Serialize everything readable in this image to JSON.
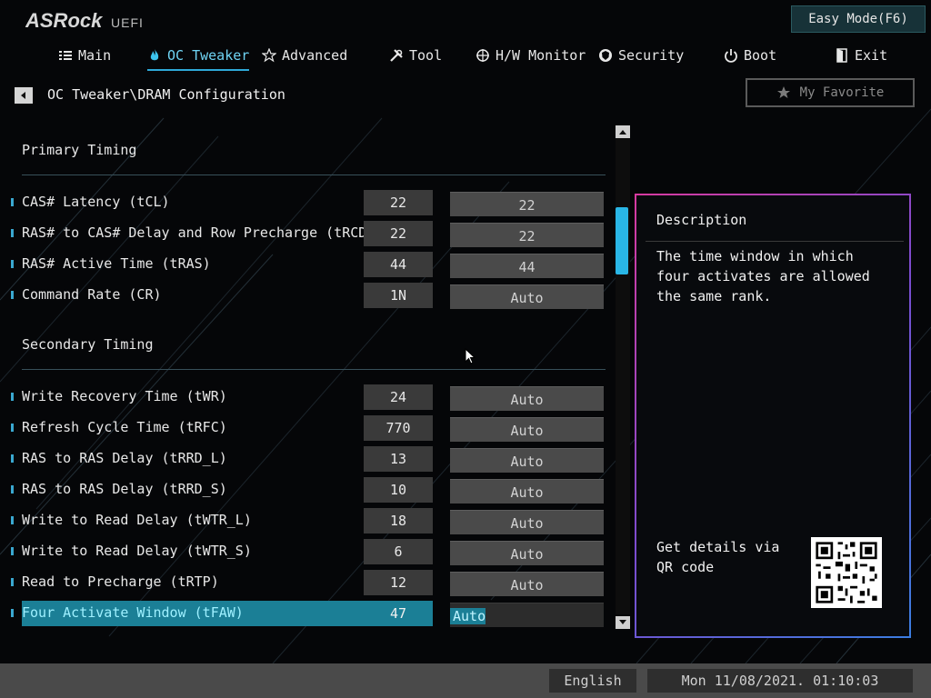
{
  "header": {
    "brand": "ASRock",
    "brand_suffix": "UEFI",
    "easy_mode_label": "Easy Mode(F6)"
  },
  "nav": {
    "items": [
      {
        "label": "Main",
        "icon": "list-icon"
      },
      {
        "label": "OC Tweaker",
        "icon": "flame-icon",
        "active": true
      },
      {
        "label": "Advanced",
        "icon": "star-icon"
      },
      {
        "label": "Tool",
        "icon": "tools-icon"
      },
      {
        "label": "H/W Monitor",
        "icon": "crosshair-icon"
      },
      {
        "label": "Security",
        "icon": "shield-icon"
      },
      {
        "label": "Boot",
        "icon": "power-icon"
      },
      {
        "label": "Exit",
        "icon": "exit-door-icon"
      }
    ]
  },
  "breadcrumb": "OC Tweaker\\DRAM Configuration",
  "favorite_label": "My Favorite",
  "sections": {
    "primary": {
      "title": "Primary Timing",
      "rows": [
        {
          "label": "CAS# Latency (tCL)",
          "current": "22",
          "setting": "22"
        },
        {
          "label": "RAS# to CAS# Delay and Row Precharge (tRCDtRP)",
          "current": "22",
          "setting": "22"
        },
        {
          "label": "RAS# Active Time (tRAS)",
          "current": "44",
          "setting": "44"
        },
        {
          "label": "Command Rate (CR)",
          "current": "1N",
          "setting": "Auto"
        }
      ]
    },
    "secondary": {
      "title": "Secondary Timing",
      "rows": [
        {
          "label": "Write Recovery Time (tWR)",
          "current": "24",
          "setting": "Auto"
        },
        {
          "label": "Refresh Cycle Time (tRFC)",
          "current": "770",
          "setting": "Auto"
        },
        {
          "label": "RAS to RAS Delay (tRRD_L)",
          "current": "13",
          "setting": "Auto"
        },
        {
          "label": "RAS to RAS Delay (tRRD_S)",
          "current": "10",
          "setting": "Auto"
        },
        {
          "label": "Write to Read Delay (tWTR_L)",
          "current": "18",
          "setting": "Auto"
        },
        {
          "label": "Write to Read Delay (tWTR_S)",
          "current": "6",
          "setting": "Auto"
        },
        {
          "label": "Read to Precharge (tRTP)",
          "current": "12",
          "setting": "Auto"
        },
        {
          "label": "Four Activate Window (tFAW)",
          "current": "47",
          "setting": "Auto",
          "selected": true
        }
      ]
    }
  },
  "description": {
    "title": "Description",
    "text": "The time window in which four activates are allowed the same rank.",
    "qr_text": "Get details via QR code"
  },
  "footer": {
    "language": "English",
    "datetime": "Mon 11/08/2021. 01:10:03"
  },
  "colors": {
    "accent": "#29b6e6",
    "selected_row": "#1b7f96",
    "panel_border_start": "#d83aa0",
    "panel_border_end": "#3b7de0"
  }
}
